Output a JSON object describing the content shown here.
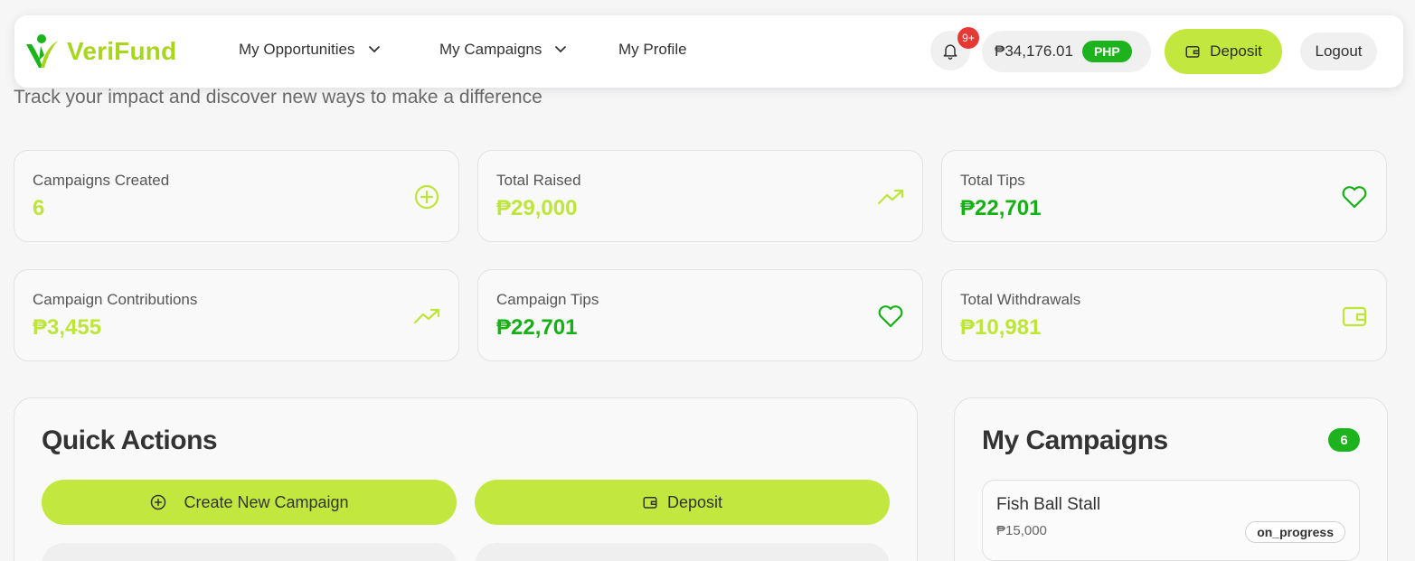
{
  "brand": {
    "name": "VeriFund",
    "logo_color": "#a8d61f"
  },
  "nav": {
    "items": [
      {
        "label": "My Opportunities",
        "has_dropdown": true
      },
      {
        "label": "My Campaigns",
        "has_dropdown": true
      },
      {
        "label": "My Profile",
        "has_dropdown": false
      }
    ],
    "notifications_badge": "9+",
    "balance": "₱34,176.01",
    "currency": "PHP",
    "deposit_label": "Deposit",
    "logout_label": "Logout"
  },
  "subtitle": "Track your impact and discover new ways to make a difference",
  "stats": [
    {
      "label": "Campaigns Created",
      "value": "6",
      "icon": "plus-circle-icon"
    },
    {
      "label": "Total Raised",
      "value": "₱29,000",
      "icon": "trending-up-icon"
    },
    {
      "label": "Total Tips",
      "value": "₱22,701",
      "icon": "heart-icon"
    },
    {
      "label": "Campaign Contributions",
      "value": "₱3,455",
      "icon": "trending-up-icon"
    },
    {
      "label": "Campaign Tips",
      "value": "₱22,701",
      "icon": "heart-icon"
    },
    {
      "label": "Total Withdrawals",
      "value": "₱10,981",
      "icon": "wallet-icon"
    }
  ],
  "quick_actions": {
    "title": "Quick Actions",
    "create_label": "Create New Campaign",
    "deposit_label": "Deposit"
  },
  "my_campaigns": {
    "title": "My Campaigns",
    "count": "6",
    "items": [
      {
        "name": "Fish Ball Stall",
        "amount": "₱15,000",
        "status": "on_progress"
      }
    ]
  },
  "colors": {
    "lime": "#c2e83f",
    "green": "#1cb31c",
    "value_lime": "#bde53a",
    "value_green": "#14b014",
    "badge_red": "#e53935"
  }
}
